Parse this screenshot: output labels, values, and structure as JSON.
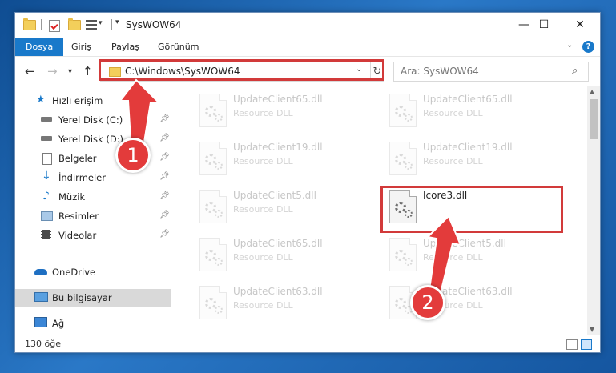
{
  "window": {
    "title": "SysWOW64",
    "buttons": {
      "minimize": "—",
      "maximize": "☐",
      "close": "✕"
    }
  },
  "ribbon": {
    "tabs": [
      {
        "label": "Dosya",
        "active": true
      },
      {
        "label": "Giriş"
      },
      {
        "label": "Paylaş"
      },
      {
        "label": "Görünüm"
      }
    ],
    "help": "?"
  },
  "address": {
    "path": "C:\\Windows\\SysWOW64",
    "search_placeholder": "Ara: SysWOW64"
  },
  "nav": {
    "items": [
      {
        "label": "Hızlı erişim",
        "icon": "star-icon"
      },
      {
        "label": "Yerel Disk (C:)",
        "icon": "drive-icon",
        "pinned": true
      },
      {
        "label": "Yerel Disk (D:)",
        "icon": "drive-icon",
        "pinned": true
      },
      {
        "label": "Belgeler",
        "icon": "documents-icon",
        "pinned": true
      },
      {
        "label": "İndirmeler",
        "icon": "download-icon",
        "pinned": true
      },
      {
        "label": "Müzik",
        "icon": "music-icon",
        "pinned": true
      },
      {
        "label": "Resimler",
        "icon": "pictures-icon",
        "pinned": true
      },
      {
        "label": "Videolar",
        "icon": "videos-icon",
        "pinned": true
      },
      {
        "label": "OneDrive",
        "icon": "cloud-icon"
      },
      {
        "label": "Bu bilgisayar",
        "icon": "computer-icon",
        "selected": true
      },
      {
        "label": "Ağ",
        "icon": "network-icon"
      }
    ]
  },
  "files": [
    {
      "name": "UpdateClient65.dll",
      "type": "Resource DLL",
      "faded": true
    },
    {
      "name": "UpdateClient65.dll",
      "type": "Resource DLL",
      "faded": true
    },
    {
      "name": "UpdateClient19.dll",
      "type": "Resource DLL",
      "faded": true
    },
    {
      "name": "UpdateClient19.dll",
      "type": "Resource DLL",
      "faded": true
    },
    {
      "name": "UpdateClient5.dll",
      "type": "Resource DLL",
      "faded": true
    },
    {
      "name": "Icore3.dll",
      "type": "",
      "faded": false,
      "highlighted": true
    },
    {
      "name": "UpdateClient65.dll",
      "type": "Resource DLL",
      "faded": true
    },
    {
      "name": "UpdateClient5.dll",
      "type": "Resource DLL",
      "faded": true
    },
    {
      "name": "UpdateClient63.dll",
      "type": "Resource DLL",
      "faded": true
    },
    {
      "name": "UpdateClient63.dll",
      "type": "Resource DLL",
      "faded": true
    }
  ],
  "status": {
    "count": "130 öğe"
  },
  "annotations": {
    "step1": "1",
    "step2": "2",
    "color": "#e33b3b"
  }
}
